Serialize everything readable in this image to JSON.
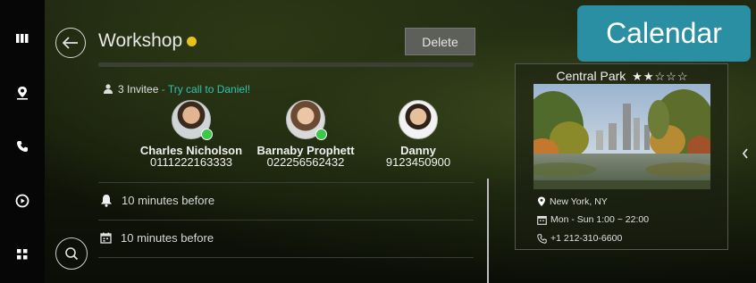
{
  "header": {
    "title": "Workshop",
    "delete_label": "Delete",
    "app_tag": "Calendar",
    "status_dot_color": "#e5c11a",
    "accent_color": "#2a8fa3"
  },
  "nav_rail": {
    "items": [
      {
        "icon": "grid-bars-icon"
      },
      {
        "icon": "map-pin-icon"
      },
      {
        "icon": "phone-icon"
      },
      {
        "icon": "play-circle-icon"
      },
      {
        "icon": "apps-icon"
      }
    ]
  },
  "invitees": {
    "count_text": "3 Invitee",
    "hint": " - Try call to Daniel!",
    "contacts": [
      {
        "name": "Charles Nicholson",
        "phone": "0111222163333",
        "callable": true
      },
      {
        "name": "Barnaby Prophett",
        "phone": "022256562432",
        "callable": true
      },
      {
        "name": "Danny",
        "phone": "9123450900",
        "callable": false
      }
    ]
  },
  "reminders": [
    {
      "icon": "bell-icon",
      "text": "10 minutes before"
    },
    {
      "icon": "calendar-icon",
      "text": "10 minutes before"
    }
  ],
  "place": {
    "name": "Central Park",
    "rating_stars": "★★☆☆☆",
    "rating": 2,
    "rating_max": 5,
    "location": "New York, NY",
    "hours": "Mon - Sun  1:00 ~ 22:00",
    "phone": "+1 212-310-6600"
  }
}
